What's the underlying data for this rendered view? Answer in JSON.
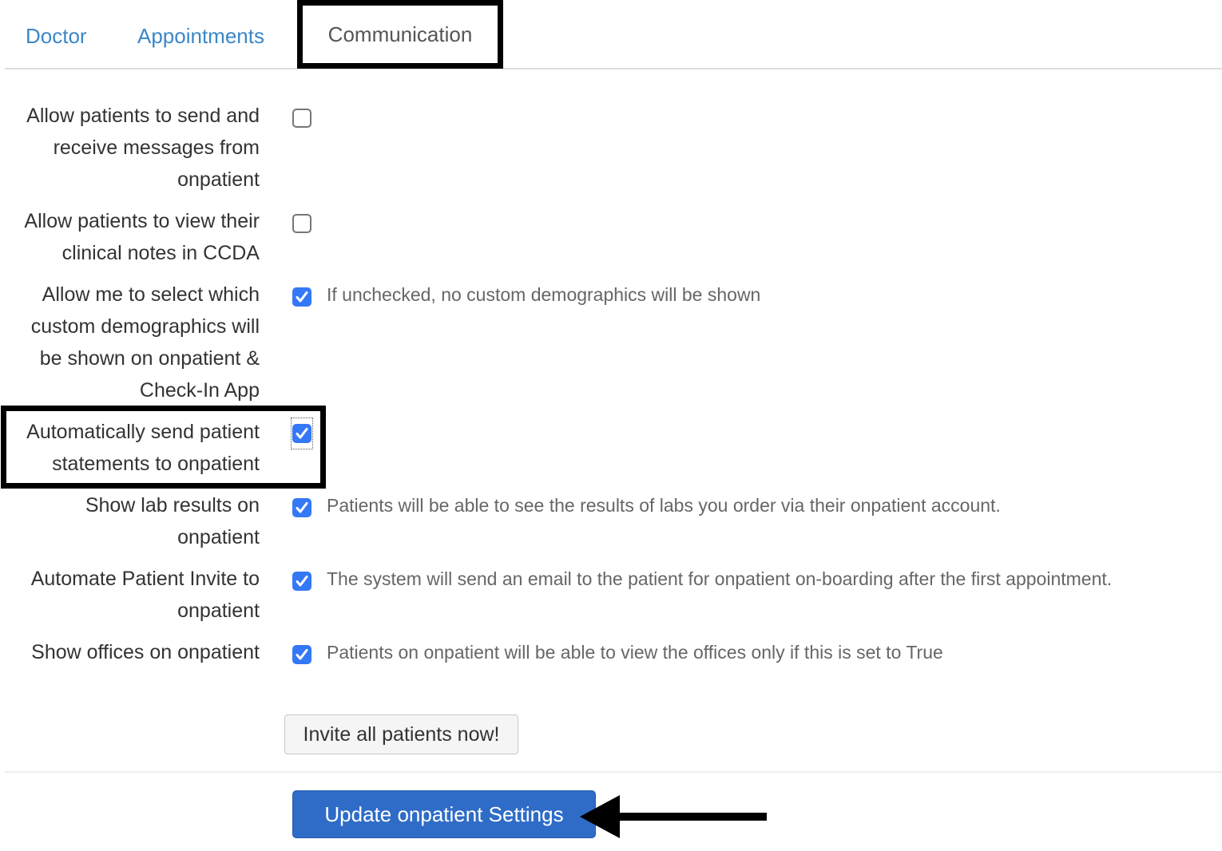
{
  "tabs": {
    "doctor": "Doctor",
    "appointments": "Appointments",
    "communication": "Communication",
    "active": "Communication"
  },
  "settings": [
    {
      "label_lines": [
        "Allow patients to send and",
        "receive messages from",
        "onpatient"
      ],
      "checked": false,
      "help": ""
    },
    {
      "label_lines": [
        "Allow patients to view their",
        "clinical notes in CCDA"
      ],
      "checked": false,
      "help": ""
    },
    {
      "label_lines": [
        "Allow me to select which",
        "custom demographics will",
        "be shown on onpatient &",
        "Check-In App"
      ],
      "checked": true,
      "help": "If unchecked, no custom demographics will be shown"
    },
    {
      "label_lines": [
        "Automatically send patient",
        "statements to onpatient"
      ],
      "checked": true,
      "help": ""
    },
    {
      "label_lines": [
        "Show lab results on",
        "onpatient"
      ],
      "checked": true,
      "help": "Patients will be able to see the results of labs you order via their onpatient account."
    },
    {
      "label_lines": [
        "Automate Patient Invite to",
        "onpatient"
      ],
      "checked": true,
      "help": "The system will send an email to the patient for onpatient on-boarding after the first appointment."
    },
    {
      "label_lines": [
        "Show offices on onpatient"
      ],
      "checked": true,
      "help": "Patients on onpatient will be able to view the offices only if this is set to True"
    }
  ],
  "buttons": {
    "invite_all": "Invite all patients now!",
    "update": "Update onpatient Settings"
  },
  "colors": {
    "link": "#3a87c8",
    "checkbox_checked": "#3478f6",
    "primary_button": "#2e6cc7"
  }
}
